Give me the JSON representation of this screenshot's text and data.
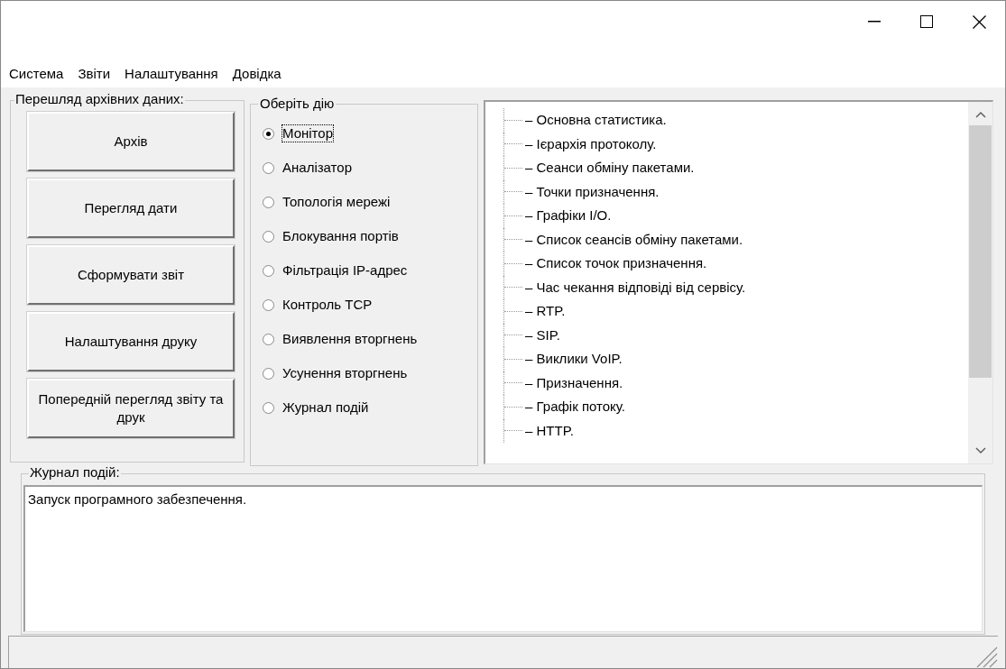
{
  "menu": [
    "Система",
    "Звіти",
    "Налаштування",
    "Довідка"
  ],
  "archive_group": {
    "title": "Перешляд архівних даних:",
    "buttons": [
      "Архів",
      "Перегляд дати",
      "Сформувати звіт",
      "Налаштування друку",
      "Попередній перегляд звіту та друк"
    ]
  },
  "action_group": {
    "title": "Оберіть дію",
    "options": [
      {
        "label": "Монітор",
        "selected": true
      },
      {
        "label": "Аналізатор",
        "selected": false
      },
      {
        "label": "Топологія мережі",
        "selected": false
      },
      {
        "label": "Блокування портів",
        "selected": false
      },
      {
        "label": "Фільтрація IP-адрес",
        "selected": false
      },
      {
        "label": "Контроль TCP",
        "selected": false
      },
      {
        "label": "Виявлення вторгнень",
        "selected": false
      },
      {
        "label": "Усунення вторгнень",
        "selected": false
      },
      {
        "label": "Журнал подій",
        "selected": false
      }
    ]
  },
  "tree": {
    "items": [
      "– Основна статистика.",
      "– Ієрархія протоколу.",
      "– Сеанси обміну пакетами.",
      "– Точки призначення.",
      "– Графіки I/O.",
      "– Список сеансів обміну пакетами.",
      "– Список точок призначення.",
      "– Час чекання відповіді від сервісу.",
      "– RTP.",
      "– SIP.",
      "– Виклики VoIP.",
      "– Призначення.",
      "– Графік потоку.",
      "– HTTP."
    ]
  },
  "log_group": {
    "title": "Журнал подій:",
    "text": "Запуск програмного забезпечення."
  }
}
